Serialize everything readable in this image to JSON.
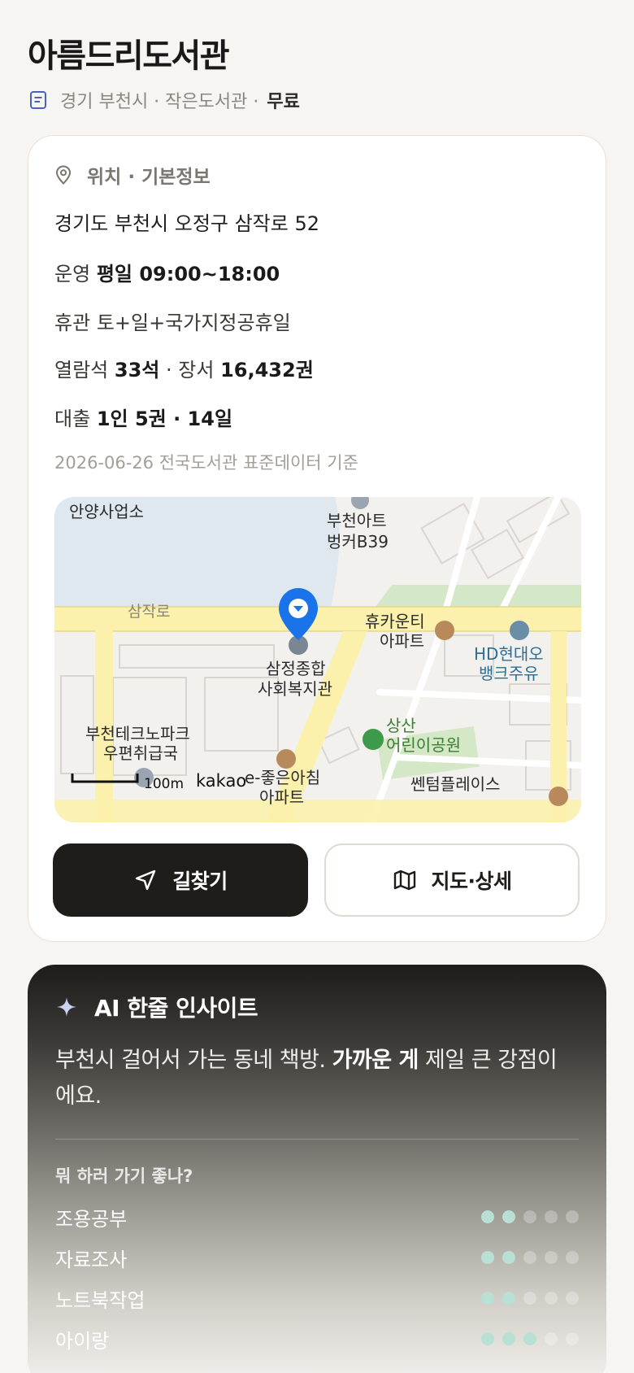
{
  "header": {
    "title": "아름드리도서관",
    "meta": "경기 부천시 · 작은도서관 ·",
    "price": "무료"
  },
  "info": {
    "section_title": "위치 · 기본정보",
    "address": "경기도 부천시 오정구 삼작로 52",
    "hours_label": "운영",
    "hours_value": "평일 09:00~18:00",
    "closed_label": "휴관",
    "closed_value": "토+일+국가지정공휴일",
    "seats_label": "열람석",
    "seats_value": "33석",
    "books_label": "· 장서",
    "books_value": "16,432권",
    "loan_label": "대출",
    "loan_value": "1인 5권 · 14일",
    "reference": "2026-06-26 전국도서관 표준데이터 기준"
  },
  "map": {
    "labels": {
      "road": "삼작로",
      "top_left": "안양사업소",
      "art1": "부천아트",
      "art2": "벙커B39",
      "apt1": "휴카운티",
      "apt2": "아파트",
      "hd1": "HD현대오",
      "hd2": "뱅크주유",
      "center1": "삼정종합",
      "center2": "사회복지관",
      "park1": "상산",
      "park2": "어린이공원",
      "post1": "부천테크노파크",
      "post2": "우편취급국",
      "morning1": "e-좋은아침",
      "morning2": "아파트",
      "centum": "쎈텀플레이스",
      "scale": "100m",
      "brand": "kakao"
    }
  },
  "actions": {
    "directions_label": "길찾기",
    "detail_label": "지도·상세"
  },
  "ai": {
    "title": "AI 한줄 인사이트",
    "text_a": "부천시 걸어서 가는 동네 책방.",
    "text_b": "가까운 게",
    "text_c": "제일 큰 강점이에요.",
    "question": "뭐 하러 가기 좋나?",
    "activities": [
      {
        "label": "조용공부",
        "score": 2,
        "max": 5
      },
      {
        "label": "자료조사",
        "score": 2,
        "max": 5
      },
      {
        "label": "노트북작업",
        "score": 2,
        "max": 5
      },
      {
        "label": "아이랑",
        "score": 3,
        "max": 5
      }
    ]
  },
  "colors": {
    "background": "#f7f5f1",
    "primary_button": "#1f1d1a",
    "accent_pin": "#1a73e8",
    "dot_on": "#b8e0d4"
  }
}
